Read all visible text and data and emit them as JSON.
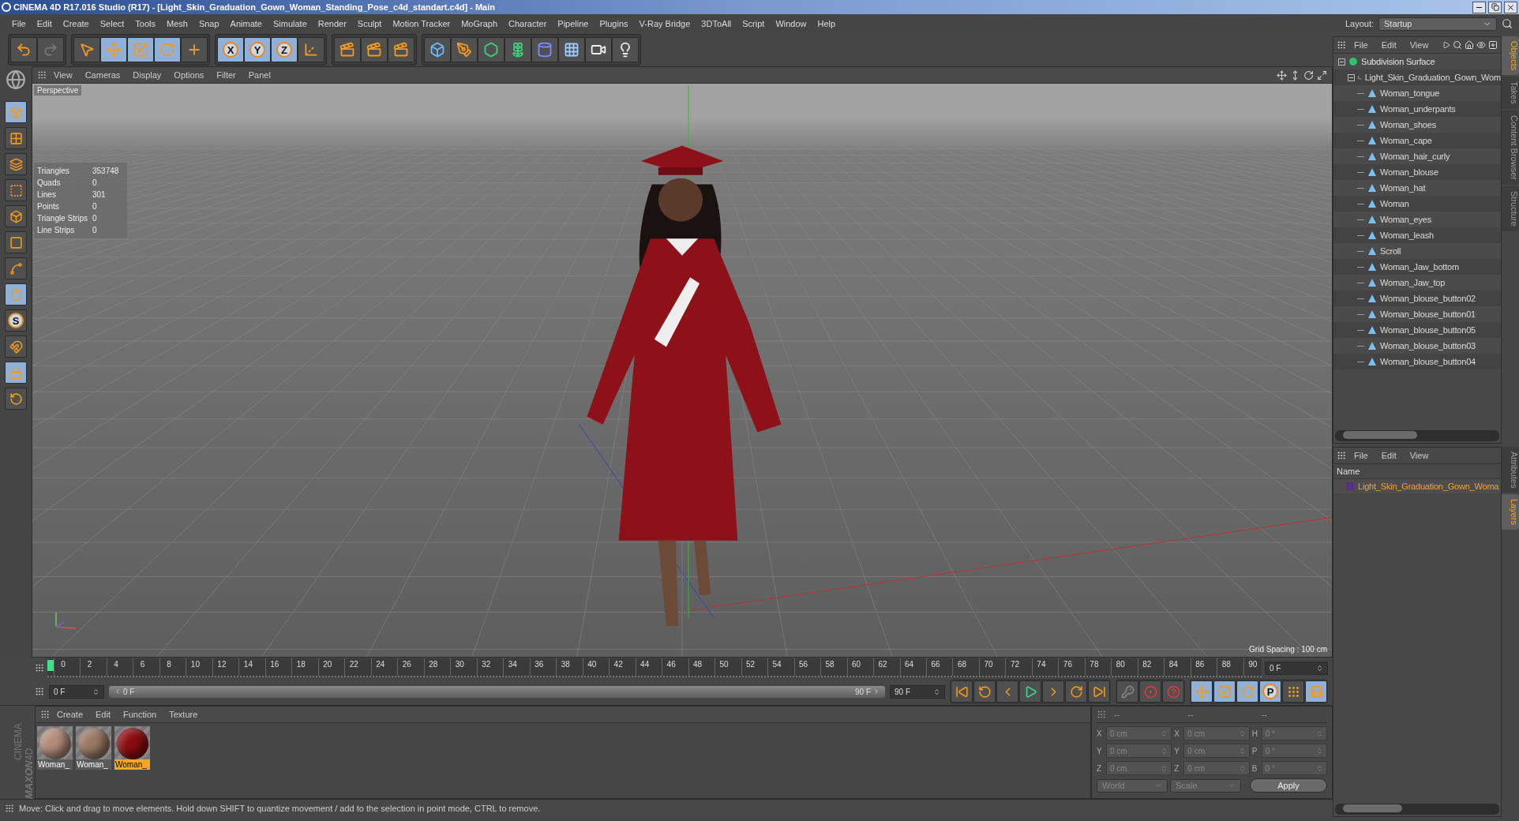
{
  "window": {
    "title": "CINEMA 4D R17.016 Studio (R17) - [Light_Skin_Graduation_Gown_Woman_Standing_Pose_c4d_standart.c4d] - Main"
  },
  "menu": [
    "File",
    "Edit",
    "Create",
    "Select",
    "Tools",
    "Mesh",
    "Snap",
    "Animate",
    "Simulate",
    "Render",
    "Sculpt",
    "Motion Tracker",
    "MoGraph",
    "Character",
    "Pipeline",
    "Plugins",
    "V-Ray Bridge",
    "3DToAll",
    "Script",
    "Window",
    "Help"
  ],
  "layout": {
    "label": "Layout:",
    "value": "Startup"
  },
  "toolbar": [
    {
      "tools": [
        {
          "kind": "undo",
          "selected": false
        },
        {
          "kind": "redo",
          "selected": false
        }
      ]
    },
    {
      "tools": [
        {
          "kind": "select",
          "selected": false
        },
        {
          "kind": "move",
          "selected": true
        },
        {
          "kind": "scale",
          "selected": true
        },
        {
          "kind": "rotate",
          "selected": true
        },
        {
          "kind": "axis-cross",
          "selected": false
        }
      ]
    },
    {
      "tools": [
        {
          "kind": "axis",
          "label": "X",
          "selected": true
        },
        {
          "kind": "axis",
          "label": "Y",
          "selected": true
        },
        {
          "kind": "axis",
          "label": "Z",
          "selected": true
        },
        {
          "kind": "coord-system",
          "selected": false
        }
      ]
    },
    {
      "tools": [
        {
          "kind": "render-view",
          "selected": false
        },
        {
          "kind": "render",
          "selected": false
        },
        {
          "kind": "render-settings",
          "selected": false
        }
      ]
    },
    {
      "tools": [
        {
          "kind": "cube",
          "selected": false
        },
        {
          "kind": "pen",
          "selected": false
        },
        {
          "kind": "subdivision",
          "selected": false
        },
        {
          "kind": "cloner",
          "selected": false
        },
        {
          "kind": "deformer",
          "selected": false
        },
        {
          "kind": "floor",
          "selected": false
        },
        {
          "kind": "camera",
          "selected": false
        },
        {
          "kind": "light",
          "selected": false
        }
      ]
    }
  ],
  "left_tools": [
    {
      "kind": "model",
      "selected": true
    },
    {
      "kind": "texture",
      "selected": false
    },
    {
      "kind": "workplane",
      "selected": false
    },
    {
      "kind": "points",
      "selected": false
    },
    {
      "kind": "edges",
      "selected": false
    },
    {
      "kind": "polygons",
      "selected": false
    },
    {
      "kind": "axis-tool",
      "selected": false
    },
    {
      "kind": "tweak",
      "selected": true
    },
    {
      "kind": "snap",
      "label": "S",
      "selected": false
    },
    {
      "kind": "magnet",
      "selected": false
    },
    {
      "kind": "grid-lock",
      "selected": true
    },
    {
      "kind": "grid-rotate",
      "selected": false
    }
  ],
  "viewport": {
    "menu": [
      "View",
      "Cameras",
      "Display",
      "Options",
      "Filter",
      "Panel"
    ],
    "camera": "Perspective",
    "stats": [
      {
        "label": "Triangles",
        "value": "353748"
      },
      {
        "label": "Quads",
        "value": "0"
      },
      {
        "label": "Lines",
        "value": "301"
      },
      {
        "label": "Points",
        "value": "0"
      },
      {
        "label": "Triangle Strips",
        "value": "0"
      },
      {
        "label": "Line Strips",
        "value": "0"
      }
    ],
    "grid_spacing": "Grid Spacing : 100 cm"
  },
  "timeline": {
    "ticks": [
      "0",
      "2",
      "4",
      "6",
      "8",
      "10",
      "12",
      "14",
      "16",
      "18",
      "20",
      "22",
      "24",
      "26",
      "28",
      "30",
      "32",
      "34",
      "36",
      "38",
      "40",
      "42",
      "44",
      "46",
      "48",
      "50",
      "52",
      "54",
      "56",
      "58",
      "60",
      "62",
      "64",
      "66",
      "68",
      "70",
      "72",
      "74",
      "76",
      "78",
      "80",
      "82",
      "84",
      "86",
      "88",
      "90"
    ],
    "level": 0,
    "current": "0 F",
    "start": "0 F",
    "range_start": "0 F",
    "range_end": "90 F",
    "range": {
      "level": 1
    },
    "end": "90 F"
  },
  "playback": [
    {
      "kind": "goto-start",
      "selected": false
    },
    {
      "kind": "prev-key",
      "selected": false
    },
    {
      "kind": "prev-frame",
      "selected": false
    },
    {
      "kind": "play",
      "selected": false
    },
    {
      "kind": "next-frame",
      "selected": false
    },
    {
      "kind": "next-key",
      "selected": false
    },
    {
      "kind": "goto-end",
      "selected": false
    }
  ],
  "record": [
    {
      "kind": "key-lock",
      "selected": false
    },
    {
      "kind": "record",
      "selected": false
    },
    {
      "kind": "autokey",
      "selected": false
    }
  ],
  "key_tracks": [
    {
      "kind": "move",
      "selected": true
    },
    {
      "kind": "scale",
      "selected": true
    },
    {
      "kind": "rotate",
      "selected": true
    },
    {
      "kind": "param",
      "label": "P",
      "selected": true
    },
    {
      "kind": "points-grid",
      "selected": false
    },
    {
      "kind": "film",
      "selected": true
    }
  ],
  "materials": {
    "menu": [
      "Create",
      "Edit",
      "Function",
      "Texture"
    ],
    "items": [
      {
        "name": "Woman_",
        "color": "#b38d7c",
        "selected": false
      },
      {
        "name": "Woman_",
        "color": "#9a7a66",
        "selected": false
      },
      {
        "name": "Woman_",
        "color": "#8c0d12",
        "selected": true
      }
    ]
  },
  "logo": {
    "brand": "MAXON",
    "product": "CINEMA 4D"
  },
  "coordinates": {
    "headers": [
      "--",
      "--",
      "--"
    ],
    "rows": [
      [
        {
          "axis": "X",
          "value": "0 cm",
          "disabled": true
        },
        {
          "axis": "X",
          "value": "0 cm",
          "disabled": true
        },
        {
          "axis": "H",
          "value": "0 °",
          "disabled": true
        }
      ],
      [
        {
          "axis": "Y",
          "value": "0 cm",
          "disabled": true
        },
        {
          "axis": "Y",
          "value": "0 cm",
          "disabled": true
        },
        {
          "axis": "P",
          "value": "0 °",
          "disabled": true
        }
      ],
      [
        {
          "axis": "Z",
          "value": "0 cm",
          "disabled": true
        },
        {
          "axis": "Z",
          "value": "0 cm",
          "disabled": true
        },
        {
          "axis": "B",
          "value": "0 °",
          "disabled": true
        }
      ]
    ],
    "dropdowns": [
      "World",
      "Scale"
    ],
    "apply": "Apply"
  },
  "status_bar": "Move: Click and drag to move elements. Hold down SHIFT to quantize movement / add to the selection in point mode, CTRL to remove.",
  "objects": {
    "menu": [
      "File",
      "Edit",
      "View"
    ],
    "tree": [
      {
        "name": "Subdivision Surface",
        "kind": "subdivision",
        "expanded": true,
        "children": [
          {
            "name": "Light_Skin_Graduation_Gown_Wom",
            "kind": "null",
            "expanded": true,
            "children": [
              {
                "name": "Woman_tongue",
                "kind": "mesh"
              },
              {
                "name": "Woman_underpants",
                "kind": "mesh"
              },
              {
                "name": "Woman_shoes",
                "kind": "mesh"
              },
              {
                "name": "Woman_cape",
                "kind": "mesh"
              },
              {
                "name": "Woman_hair_curly",
                "kind": "mesh"
              },
              {
                "name": "Woman_blouse",
                "kind": "mesh"
              },
              {
                "name": "Woman_hat",
                "kind": "mesh"
              },
              {
                "name": "Woman",
                "kind": "mesh"
              },
              {
                "name": "Woman_eyes",
                "kind": "mesh"
              },
              {
                "name": "Woman_leash",
                "kind": "mesh"
              },
              {
                "name": "Scroll",
                "kind": "mesh"
              },
              {
                "name": "Woman_Jaw_bottom",
                "kind": "mesh"
              },
              {
                "name": "Woman_Jaw_top",
                "kind": "mesh"
              },
              {
                "name": "Woman_blouse_button02",
                "kind": "mesh"
              },
              {
                "name": "Woman_blouse_button01",
                "kind": "mesh"
              },
              {
                "name": "Woman_blouse_button05",
                "kind": "mesh"
              },
              {
                "name": "Woman_blouse_button03",
                "kind": "mesh"
              },
              {
                "name": "Woman_blouse_button04",
                "kind": "mesh"
              }
            ]
          }
        ]
      }
    ],
    "tabs": [
      {
        "label": "Objects",
        "selected": true
      },
      {
        "label": "Takes",
        "selected": false
      },
      {
        "label": "Content Browser",
        "selected": false
      },
      {
        "label": "Structure",
        "selected": false
      }
    ]
  },
  "layers": {
    "menu": [
      "File",
      "Edit",
      "View"
    ],
    "column": "Name",
    "items": [
      {
        "name": "Light_Skin_Graduation_Gown_Woma",
        "color": "#5b2f86"
      }
    ],
    "tabs": [
      {
        "label": "Attributes",
        "selected": false
      },
      {
        "label": "Layers",
        "selected": true
      }
    ]
  }
}
